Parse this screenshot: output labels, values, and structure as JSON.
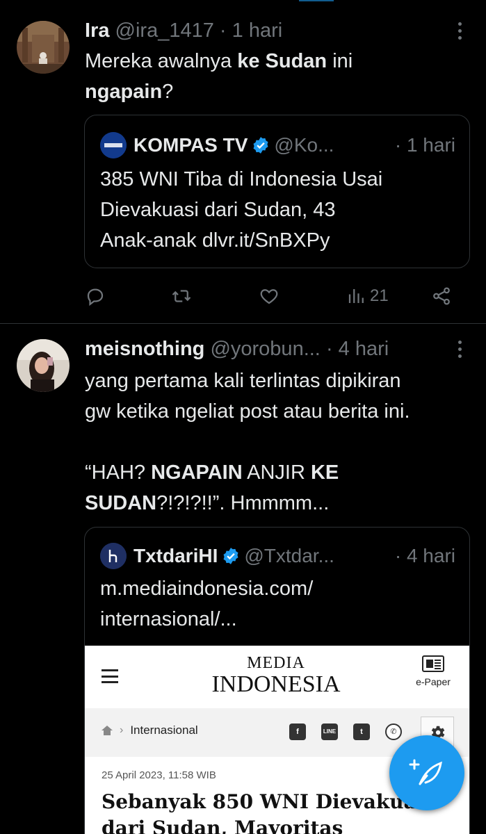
{
  "colors": {
    "accent": "#1d9bf0",
    "muted": "#71767b",
    "text": "#e7e9ea",
    "border": "#2f3336"
  },
  "tweets": [
    {
      "name": "Ira",
      "handle": "@ira_1417",
      "sep": "·",
      "time": "1 hari",
      "body": {
        "p1": "Mereka awalnya ",
        "b1": "ke Sudan",
        "p2": " ini ",
        "b2": "ngapain",
        "p3": "?"
      },
      "quote": {
        "name": "KOMPAS TV",
        "handle": "@Ko...",
        "time": "· 1 hari",
        "text_l1": "385 WNI Tiba di Indonesia Usai",
        "text_l2": "Dievakuasi dari Sudan, 43",
        "text_l3": "Anak-anak dlvr.it/SnBXPy"
      },
      "actions": {
        "views": "21",
        "reply_icon": "reply-icon",
        "retweet_icon": "retweet-icon",
        "like_icon": "heart-icon",
        "views_icon": "views-icon",
        "share_icon": "share-icon"
      }
    },
    {
      "name": "meisnothing",
      "handle": "@yorobun...",
      "time": "· 4 hari",
      "body": {
        "l1": "yang pertama kali terlintas dipikiran",
        "l2": "gw ketika ngeliat post atau berita ini.",
        "q_open": "“HAH? ",
        "b1": "NGAPAIN",
        "mid": " ANJIR ",
        "b2": "KE",
        "b3": "SUDAN",
        "q_close": "?!?!?!!”. Hmmmm..."
      },
      "quote": {
        "name": "TxtdariHI",
        "handle": "@Txtdar...",
        "time": "· 4 hari",
        "text_l1": "m.mediaindonesia.com/",
        "text_l2": "internasional/..."
      },
      "article": {
        "logo_l1": "MEDIA",
        "logo_l2": "INDONESIA",
        "epaper": "e-Paper",
        "crumb": "Internasional",
        "date": "25 April 2023, 11:58 WIB",
        "title": "Sebanyak 850 WNI Dievakuasi dari Sudan, Mayoritas"
      }
    }
  ],
  "fab": {
    "icon": "compose-feather-icon"
  }
}
